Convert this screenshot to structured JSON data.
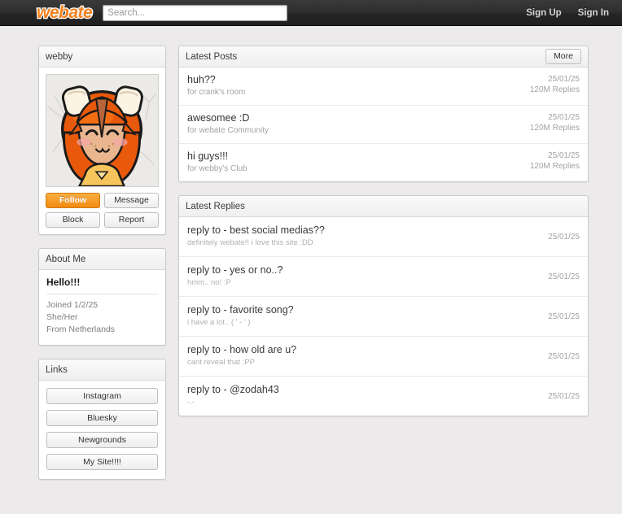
{
  "header": {
    "logo_text": "webate",
    "search": {
      "value": "",
      "placeholder": "Search..."
    },
    "sign_up_label": "Sign Up",
    "sign_in_label": "Sign In",
    "background_color": "#2b2b2b",
    "logo_color": "#f58220"
  },
  "sidebar": {
    "profile": {
      "username": "webby",
      "avatar_alt": "webby-avatar",
      "buttons": [
        {
          "label": "Follow",
          "primary": true
        },
        {
          "label": "Message",
          "primary": false
        },
        {
          "label": "Block",
          "primary": false
        },
        {
          "label": "Report",
          "primary": false
        }
      ]
    },
    "about": {
      "header": "About Me",
      "title": "Hello!!!",
      "lines": [
        "Joined 1/2/25",
        "She/Her",
        "From Netherlands"
      ]
    },
    "links": {
      "header": "Links",
      "items": [
        {
          "label": "Instagram"
        },
        {
          "label": "Bluesky"
        },
        {
          "label": "Newgrounds"
        },
        {
          "label": "My Site!!!!"
        }
      ]
    }
  },
  "main": {
    "latest_posts": {
      "header": "Latest Posts",
      "more_label": "More",
      "rows": [
        {
          "title": "huh??",
          "sub": "for crank's room",
          "date": "25/01/25",
          "meta": "120M Replies"
        },
        {
          "title": "awesomee :D",
          "sub": "for webate Community",
          "date": "25/01/25",
          "meta": "120M Replies"
        },
        {
          "title": "hi guys!!!",
          "sub": "for webby's Club",
          "date": "25/01/25",
          "meta": "120M Replies"
        }
      ]
    },
    "latest_replies": {
      "header": "Latest Replies",
      "rows": [
        {
          "title": "reply to - best social medias??",
          "sub": "definitely webate!! i love this site :DD",
          "date": "25/01/25"
        },
        {
          "title": "reply to - yes or no..?",
          "sub": "hmm.. no! :P",
          "date": "25/01/25"
        },
        {
          "title": "reply to - favorite song?",
          "sub": "i have a lot.. ( ' - ' )",
          "date": "25/01/25"
        },
        {
          "title": "reply to - how old are u?",
          "sub": "cant reveal that :PP",
          "date": "25/01/25"
        },
        {
          "title": "reply to - @zodah43",
          "sub": "-.-",
          "date": "25/01/25"
        }
      ]
    }
  }
}
